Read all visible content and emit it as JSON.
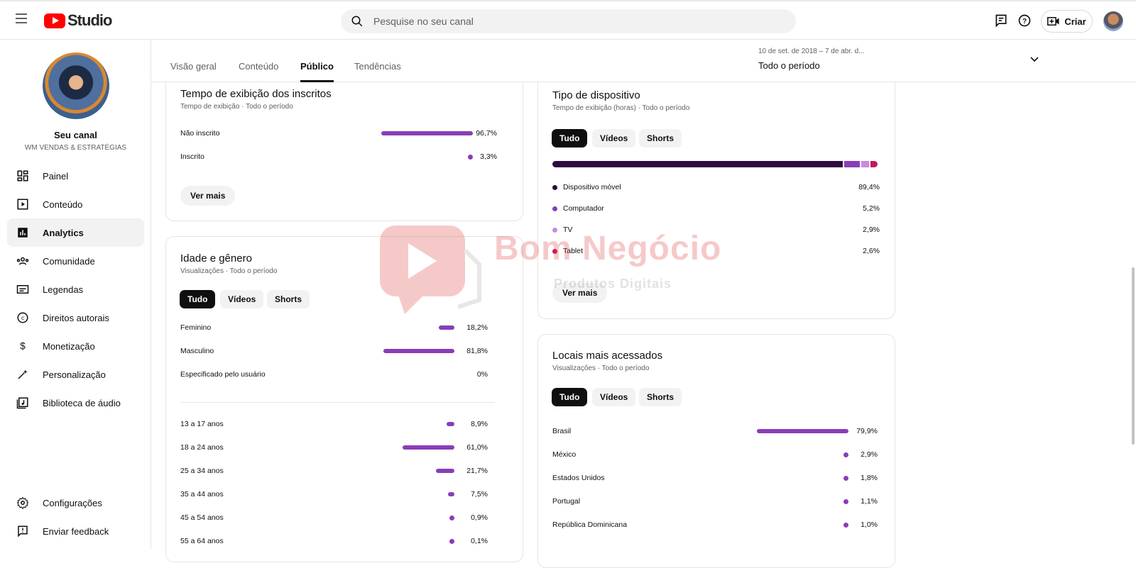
{
  "header": {
    "logo_text": "Studio",
    "search_placeholder": "Pesquise no seu canal",
    "create_label": "Criar"
  },
  "sidebar": {
    "channel_title": "Seu canal",
    "channel_name": "WM VENDAS & ESTRATÉGIAS",
    "items": [
      {
        "label": "Painel",
        "icon": "dashboard-icon"
      },
      {
        "label": "Conteúdo",
        "icon": "content-icon"
      },
      {
        "label": "Analytics",
        "icon": "analytics-icon",
        "active": true
      },
      {
        "label": "Comunidade",
        "icon": "community-icon"
      },
      {
        "label": "Legendas",
        "icon": "subtitles-icon"
      },
      {
        "label": "Direitos autorais",
        "icon": "copyright-icon"
      },
      {
        "label": "Monetização",
        "icon": "monetization-icon"
      },
      {
        "label": "Personalização",
        "icon": "customization-icon"
      },
      {
        "label": "Biblioteca de áudio",
        "icon": "audio-library-icon"
      }
    ],
    "bottom_items": [
      {
        "label": "Configurações",
        "icon": "settings-icon"
      },
      {
        "label": "Enviar feedback",
        "icon": "feedback-icon"
      }
    ]
  },
  "tabs": [
    {
      "label": "Visão geral"
    },
    {
      "label": "Conteúdo"
    },
    {
      "label": "Público",
      "active": true
    },
    {
      "label": "Tendências"
    }
  ],
  "period": {
    "range": "10 de set. de 2018 – 7 de abr. d...",
    "label": "Todo o período"
  },
  "filter_chips": [
    "Tudo",
    "Vídeos",
    "Shorts"
  ],
  "see_more": "Ver mais",
  "subscriber_watch": {
    "title": "Tempo de exibição dos inscritos",
    "subtitle": "Tempo de exibição · Todo o período",
    "rows": [
      {
        "label": "Não inscrito",
        "value": "96,7%",
        "pct": 96.7
      },
      {
        "label": "Inscrito",
        "value": "3,3%",
        "pct": 3.3
      }
    ]
  },
  "age_gender": {
    "title": "Idade e gênero",
    "subtitle": "Visualizações · Todo o período",
    "gender_rows": [
      {
        "label": "Feminino",
        "value": "18,2%",
        "pct": 18.2
      },
      {
        "label": "Masculino",
        "value": "81,8%",
        "pct": 81.8
      },
      {
        "label": "Especificado pelo usuário",
        "value": "0%",
        "pct": 0
      }
    ],
    "age_rows": [
      {
        "label": "13 a 17 anos",
        "value": "8,9%",
        "pct": 8.9
      },
      {
        "label": "18 a 24 anos",
        "value": "61,0%",
        "pct": 61.0
      },
      {
        "label": "25 a 34 anos",
        "value": "21,7%",
        "pct": 21.7
      },
      {
        "label": "35 a 44 anos",
        "value": "7,5%",
        "pct": 7.5
      },
      {
        "label": "45 a 54 anos",
        "value": "0,9%",
        "pct": 0.9
      },
      {
        "label": "55 a 64 anos",
        "value": "0,1%",
        "pct": 0.1
      }
    ]
  },
  "device_type": {
    "title": "Tipo de dispositivo",
    "subtitle": "Tempo de exibição (horas) · Todo o período",
    "rows": [
      {
        "label": "Dispositivo móvel",
        "value": "89,4%",
        "pct": 89.4,
        "color": "#2c0a3f"
      },
      {
        "label": "Computador",
        "value": "5,2%",
        "pct": 5.2,
        "color": "#8a3db7"
      },
      {
        "label": "TV",
        "value": "2,9%",
        "pct": 2.9,
        "color": "#c78be0"
      },
      {
        "label": "Tablet",
        "value": "2,6%",
        "pct": 2.6,
        "color": "#c2185b"
      }
    ]
  },
  "top_locations": {
    "title": "Locais mais acessados",
    "subtitle": "Visualizações · Todo o período",
    "rows": [
      {
        "label": "Brasil",
        "value": "79,9%",
        "pct": 79.9
      },
      {
        "label": "México",
        "value": "2,9%",
        "pct": 2.9
      },
      {
        "label": "Estados Unidos",
        "value": "1,8%",
        "pct": 1.8
      },
      {
        "label": "Portugal",
        "value": "1,1%",
        "pct": 1.1
      },
      {
        "label": "República Dominicana",
        "value": "1,0%",
        "pct": 1.0
      }
    ]
  },
  "watermark": {
    "brand": "Bom Negócio",
    "tagline": "Produtos Digitais"
  },
  "colors": {
    "bar": "#8a3db7",
    "chip_selected": "#0f0f0f",
    "logo_red": "#ff0000"
  }
}
